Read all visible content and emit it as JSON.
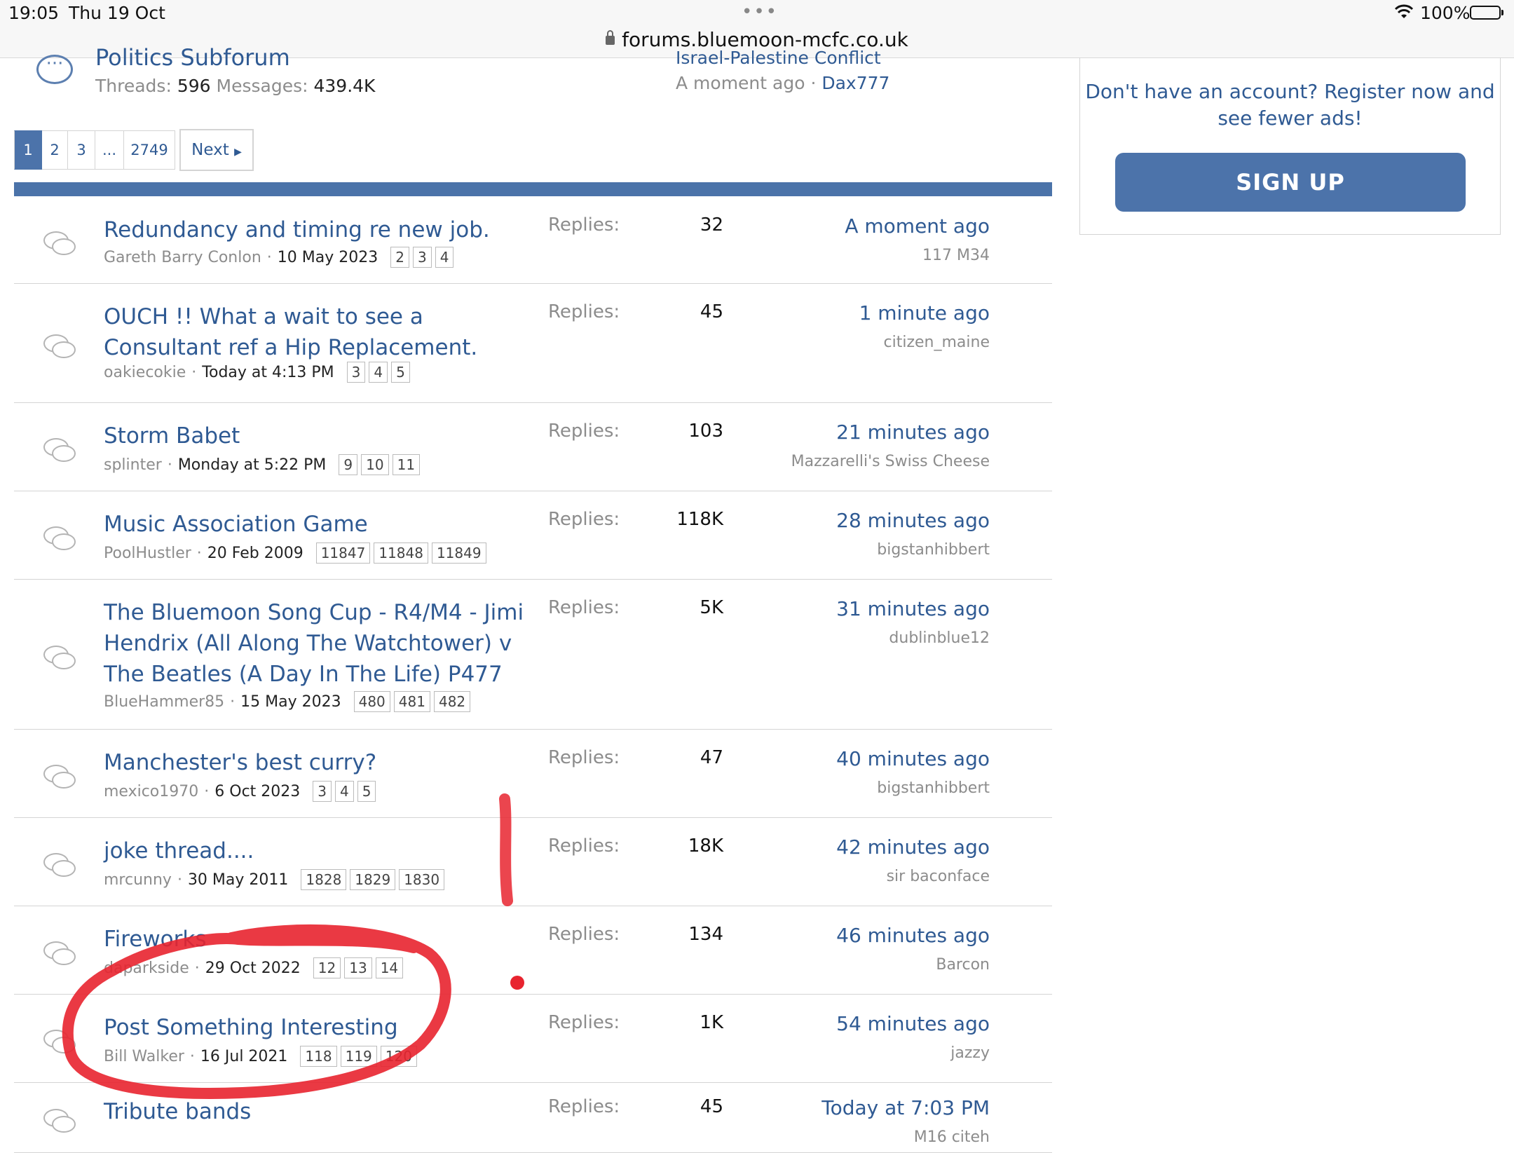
{
  "status_bar": {
    "time": "19:05",
    "date": "Thu 19 Oct",
    "dots": "•••",
    "url": "forums.bluemoon-mcfc.co.uk",
    "battery": "100%"
  },
  "subforum": {
    "title": "Politics Subforum",
    "threads_label": "Threads:",
    "threads_value": "596",
    "messages_label": "Messages:",
    "messages_value": "439.4K",
    "latest_title": "Israel-Palestine Conflict",
    "latest_time": "A moment ago",
    "latest_user": "Dax777"
  },
  "pagination": {
    "pages": [
      "1",
      "2",
      "3",
      "...",
      "2749"
    ],
    "active": "1",
    "next": "Next"
  },
  "sidebar": {
    "text": "Don't have an account? Register now and see fewer ads!",
    "button": "SIGN UP"
  },
  "replies_label": "Replies:",
  "threads": [
    {
      "title": "Redundancy and timing re new job.",
      "author": "Gareth Barry Conlon",
      "date": "10 May 2023",
      "pages": [
        "2",
        "3",
        "4"
      ],
      "replies": "32",
      "last_time": "A moment ago",
      "last_user": "117 M34"
    },
    {
      "title": "OUCH !! What a wait to see a Consultant ref a Hip Replacement.",
      "author": "oakiecokie",
      "date": "Today at 4:13 PM",
      "pages": [
        "3",
        "4",
        "5"
      ],
      "replies": "45",
      "last_time": "1 minute ago",
      "last_user": "citizen_maine"
    },
    {
      "title": "Storm Babet",
      "author": "splinter",
      "date": "Monday at 5:22 PM",
      "pages": [
        "9",
        "10",
        "11"
      ],
      "replies": "103",
      "last_time": "21 minutes ago",
      "last_user": "Mazzarelli's Swiss Cheese"
    },
    {
      "title": "Music Association Game",
      "author": "PoolHustler",
      "date": "20 Feb 2009",
      "pages": [
        "11847",
        "11848",
        "11849"
      ],
      "replies": "118K",
      "last_time": "28 minutes ago",
      "last_user": "bigstanhibbert"
    },
    {
      "title": "The Bluemoon Song Cup - R4/M4 - Jimi Hendrix (All Along The Watchtower) v The Beatles (A Day In The Life) P477",
      "author": "BlueHammer85",
      "date": "15 May 2023",
      "pages": [
        "480",
        "481",
        "482"
      ],
      "replies": "5K",
      "last_time": "31 minutes ago",
      "last_user": "dublinblue12"
    },
    {
      "title": "Manchester's best curry?",
      "author": "mexico1970",
      "date": "6 Oct 2023",
      "pages": [
        "3",
        "4",
        "5"
      ],
      "replies": "47",
      "last_time": "40 minutes ago",
      "last_user": "bigstanhibbert"
    },
    {
      "title": "joke thread....",
      "author": "mrcunny",
      "date": "30 May 2011",
      "pages": [
        "1828",
        "1829",
        "1830"
      ],
      "replies": "18K",
      "last_time": "42 minutes ago",
      "last_user": "sir baconface"
    },
    {
      "title": "Fireworks",
      "author": "daparkside",
      "date": "29 Oct 2022",
      "pages": [
        "12",
        "13",
        "14"
      ],
      "replies": "134",
      "last_time": "46 minutes ago",
      "last_user": "Barcon"
    },
    {
      "title": "Post Something Interesting",
      "author": "Bill Walker",
      "date": "16 Jul 2021",
      "pages": [
        "118",
        "119",
        "120"
      ],
      "replies": "1K",
      "last_time": "54 minutes ago",
      "last_user": "jazzy"
    },
    {
      "title": "Tribute bands",
      "author": "",
      "date": "",
      "pages": [],
      "replies": "45",
      "last_time": "Today at 7:03 PM",
      "last_user": "M16 citeh"
    }
  ]
}
